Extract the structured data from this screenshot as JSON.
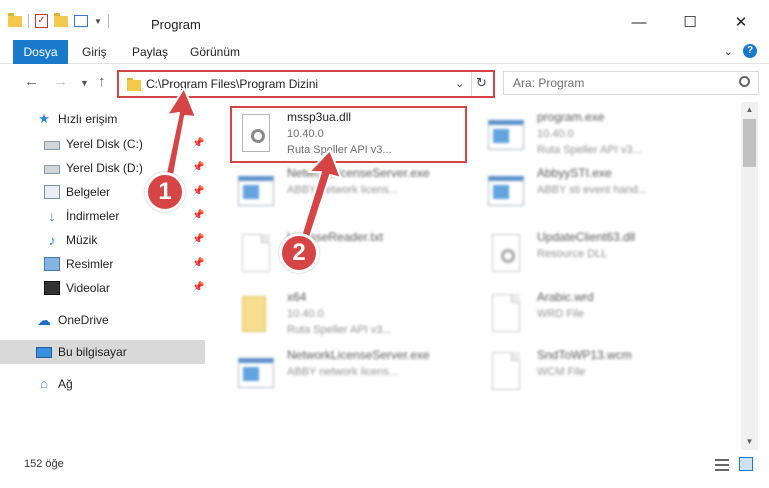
{
  "window": {
    "title": "Program",
    "minimize_icon": "minimize-icon",
    "maximize_icon": "maximize-icon",
    "close_icon": "close-icon"
  },
  "ribbon": {
    "tabs": [
      "Dosya",
      "Giriş",
      "Paylaş",
      "Görünüm"
    ],
    "active_tab": "Dosya",
    "accent_color": "#1979ca"
  },
  "address": {
    "path": "C:\\Program Files\\Program Dizini",
    "highlight_color": "#d64545"
  },
  "search": {
    "placeholder": "Ara: Program"
  },
  "sidebar": {
    "quick_access": "Hızlı erişim",
    "items": [
      {
        "label": "Yerel Disk (C:)",
        "icon": "drive-icon",
        "pinned": true
      },
      {
        "label": "Yerel Disk (D:)",
        "icon": "drive-icon",
        "pinned": true
      },
      {
        "label": "Belgeler",
        "icon": "documents-icon",
        "pinned": true
      },
      {
        "label": "İndirmeler",
        "icon": "download-icon",
        "pinned": true
      },
      {
        "label": "Müzik",
        "icon": "music-icon",
        "pinned": true
      },
      {
        "label": "Resimler",
        "icon": "pictures-icon",
        "pinned": true
      },
      {
        "label": "Videolar",
        "icon": "video-icon",
        "pinned": true
      }
    ],
    "onedrive": "OneDrive",
    "this_pc": "Bu bilgisayar",
    "network": "Ağ"
  },
  "files": [
    {
      "name": "mssp3ua.dll",
      "line2": "10.40.0",
      "line3": "Ruta Speller API v3...",
      "kind": "dll",
      "highlighted": true
    },
    {
      "name": "program.exe",
      "line2": "10.40.0",
      "line3": "Ruta Speller API v3...",
      "kind": "exe",
      "highlighted": false
    },
    {
      "name": "NetworkLicenseServer.exe",
      "line2": "ABBY network licens...",
      "line3": "",
      "kind": "exe",
      "highlighted": false
    },
    {
      "name": "AbbyySTI.exe",
      "line2": "ABBY sti event hand...",
      "line3": "",
      "kind": "exe",
      "highlighted": false
    },
    {
      "name": "LicenseReader.txt",
      "line2": "",
      "line3": "",
      "kind": "doc",
      "highlighted": false
    },
    {
      "name": "UpdateClient63.dll",
      "line2": "Resource DLL",
      "line3": "",
      "kind": "dll",
      "highlighted": false
    },
    {
      "name": "x64",
      "line2": "10.40.0",
      "line3": "Ruta Speller API v3...",
      "kind": "folder",
      "highlighted": false
    },
    {
      "name": "Arabic.wrd",
      "line2": "WRD File",
      "line3": "",
      "kind": "doc",
      "highlighted": false
    },
    {
      "name": "NetworkLicenseServer.exe",
      "line2": "ABBY network licens...",
      "line3": "",
      "kind": "exe",
      "highlighted": false
    },
    {
      "name": "SndToWP13.wcm",
      "line2": "WCM File",
      "line3": "",
      "kind": "doc",
      "highlighted": false
    }
  ],
  "annotations": {
    "step1": "1",
    "step2": "2",
    "color": "#d64545"
  },
  "status": {
    "item_count": "152 öğe"
  }
}
